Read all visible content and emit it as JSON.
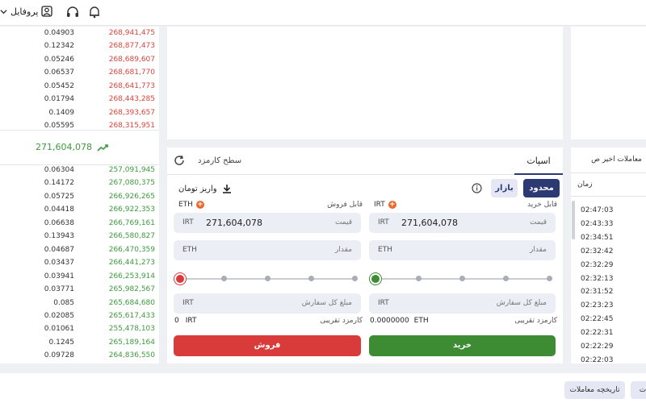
{
  "header": {
    "profile_label": "پروفایل",
    "icons": [
      "chevron-down-icon",
      "user-icon",
      "headset-icon",
      "bell-icon"
    ]
  },
  "orderbook": {
    "sells": [
      {
        "amount": "0.04903",
        "price": "268,941,475"
      },
      {
        "amount": "0.12342",
        "price": "268,877,473"
      },
      {
        "amount": "0.05246",
        "price": "268,689,607"
      },
      {
        "amount": "0.06537",
        "price": "268,681,770"
      },
      {
        "amount": "0.05452",
        "price": "268,641,773"
      },
      {
        "amount": "0.01794",
        "price": "268,443,285"
      },
      {
        "amount": "0.1409",
        "price": "268,393,657"
      },
      {
        "amount": "0.05595",
        "price": "268,315,951"
      }
    ],
    "last_price": "271,604,078",
    "buys": [
      {
        "amount": "0.06304",
        "price": "257,091,945"
      },
      {
        "amount": "0.14172",
        "price": "267,080,375"
      },
      {
        "amount": "0.05725",
        "price": "266,926,265"
      },
      {
        "amount": "0.04418",
        "price": "266,922,353"
      },
      {
        "amount": "0.06638",
        "price": "266,769,161"
      },
      {
        "amount": "0.13943",
        "price": "266,580,827"
      },
      {
        "amount": "0.04687",
        "price": "266,470,359"
      },
      {
        "amount": "0.03437",
        "price": "266,441,273"
      },
      {
        "amount": "0.03941",
        "price": "266,253,914"
      },
      {
        "amount": "0.03771",
        "price": "265,982,567"
      },
      {
        "amount": "0.085",
        "price": "265,684,680"
      },
      {
        "amount": "0.02085",
        "price": "265,617,433"
      },
      {
        "amount": "0.01061",
        "price": "255,478,103"
      },
      {
        "amount": "0.1245",
        "price": "265,189,164"
      },
      {
        "amount": "0.09728",
        "price": "264,836,550"
      }
    ]
  },
  "order_form": {
    "tab_spot": "اسپات",
    "tab_fee": "سطح کارمزد",
    "btn_limit": "محدود",
    "btn_market": "بازار",
    "deposit_label": "واریز تومان",
    "buy": {
      "available_label": "قابل خرید",
      "available_unit": "IRT",
      "price_unit": "IRT",
      "price_value": "271,604,078",
      "price_placeholder": "قیمت",
      "amount_unit": "ETH",
      "amount_placeholder": "مقدار",
      "total_unit": "IRT",
      "total_placeholder": "مبلغ کل سفارش",
      "fee_label": "کارمزد تقریبی",
      "fee_value": "0.0000000",
      "fee_unit": "ETH",
      "submit_label": "خرید",
      "slider_value": 0
    },
    "sell": {
      "available_label": "قابل فروش",
      "available_unit": "ETH",
      "price_unit": "IRT",
      "price_value": "271,604,078",
      "price_placeholder": "قیمت",
      "amount_unit": "ETH",
      "amount_placeholder": "مقدار",
      "total_unit": "IRT",
      "total_placeholder": "مبلغ کل سفارش",
      "fee_label": "کارمزد تقریبی",
      "fee_value": "0",
      "fee_unit": "IRT",
      "submit_label": "فروش",
      "slider_value": 0
    }
  },
  "recent_trades": {
    "title": "معاملات اخیر ص",
    "time_header": "زمان",
    "times": [
      "02:47:03",
      "02:43:33",
      "02:34:51",
      "02:32:42",
      "02:32:29",
      "02:32:13",
      "02:31:52",
      "02:23:23",
      "02:22:45",
      "02:22:31",
      "02:22:29",
      "02:22:03"
    ]
  },
  "footer": {
    "history_label": "تاریخچه معاملات",
    "next_label": "ت"
  },
  "colors": {
    "buy": "#3d8c34",
    "sell": "#d93a3a",
    "primary": "#2c3a73",
    "sell_text": "#d9433a",
    "buy_text": "#3d9a3d"
  }
}
